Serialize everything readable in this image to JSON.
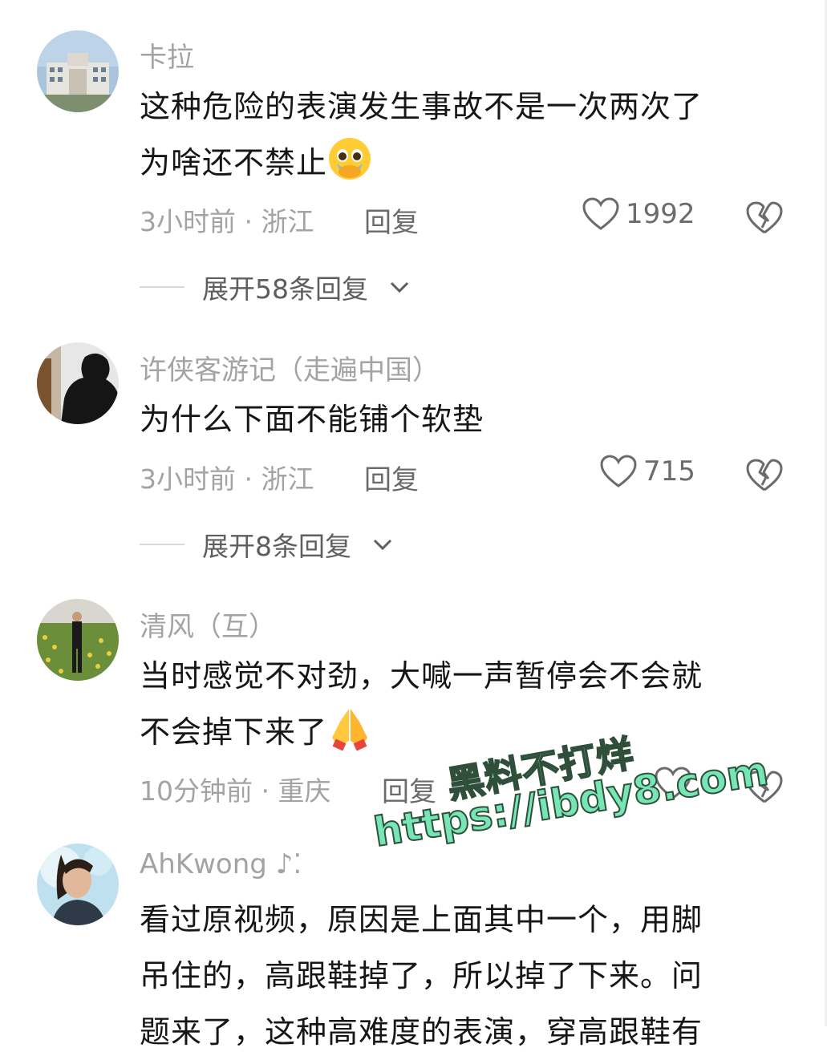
{
  "comments": [
    {
      "username": "卡拉",
      "text_line1": "这种危险的表演发生事故不是一次两次了",
      "text_line2": "为啥还不禁止",
      "emoji": "pleading-face-hands-over-mouth",
      "meta": "3小时前 · 浙江",
      "reply_label": "回复",
      "likes": "1992",
      "expand_label": "展开58条回复"
    },
    {
      "username": "许侠客游记（走遍中国）",
      "text_line1": "为什么下面不能铺个软垫",
      "meta": "3小时前 · 浙江",
      "reply_label": "回复",
      "likes": "715",
      "expand_label": "展开8条回复"
    },
    {
      "username": "清风（互）",
      "text_line1": "当时感觉不对劲，大喊一声暂停会不会就",
      "text_line2": "不会掉下来了",
      "emoji": "folded-hands",
      "meta": "10分钟前 · 重庆",
      "reply_label": "回复",
      "likes": ""
    },
    {
      "username": "AhKwong ♪⁚",
      "text_line1": "看过原视频，原因是上面其中一个，用脚",
      "text_line2": "吊住的，高跟鞋掉了，所以掉了下来。问",
      "text_line3": "题来了，这种高难度的表演，穿高跟鞋有"
    }
  ],
  "watermark": {
    "line1": "黑料不打烊",
    "line2": "https://ibdy8.com"
  },
  "colors": {
    "meta_gray": "#a3a3a6",
    "text_dark": "#161616",
    "watermark_green": "#77e6b6"
  }
}
